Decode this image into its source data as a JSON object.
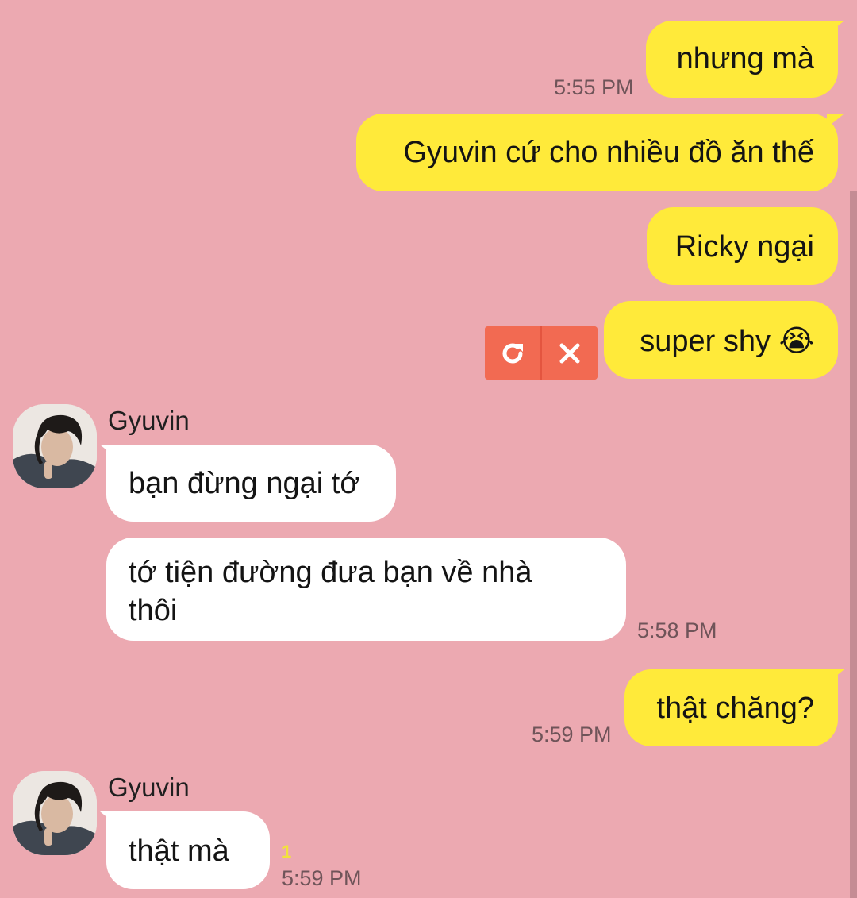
{
  "conversation": {
    "messages": [
      {
        "from": "me",
        "text": "nhưng mà",
        "time": "5:55 PM"
      },
      {
        "from": "me",
        "text": "Gyuvin cứ cho nhiều đồ ăn thế"
      },
      {
        "from": "me",
        "text": "Ricky ngại"
      },
      {
        "from": "me",
        "text": "super shy 😭",
        "status": "failed"
      },
      {
        "from": "Gyuvin",
        "text": "bạn đừng ngại tớ"
      },
      {
        "from": "Gyuvin",
        "text_line1": "tớ tiện đường đưa bạn về nhà",
        "text_line2": "thôi",
        "time": "5:58 PM"
      },
      {
        "from": "me",
        "text": "thật chăng?",
        "time": "5:59 PM"
      },
      {
        "from": "Gyuvin",
        "text": "thật mà",
        "time": "5:59 PM",
        "unread_count": "1"
      }
    ],
    "sender_name": "Gyuvin"
  },
  "failed_actions": {
    "retry_icon": "retry-icon",
    "cancel_icon": "close-icon"
  },
  "colors": {
    "background": "#eca9b1",
    "my_bubble": "#ffea3a",
    "their_bubble": "#ffffff",
    "failed_action": "#f26a52",
    "unread_count": "#f2e23a"
  }
}
